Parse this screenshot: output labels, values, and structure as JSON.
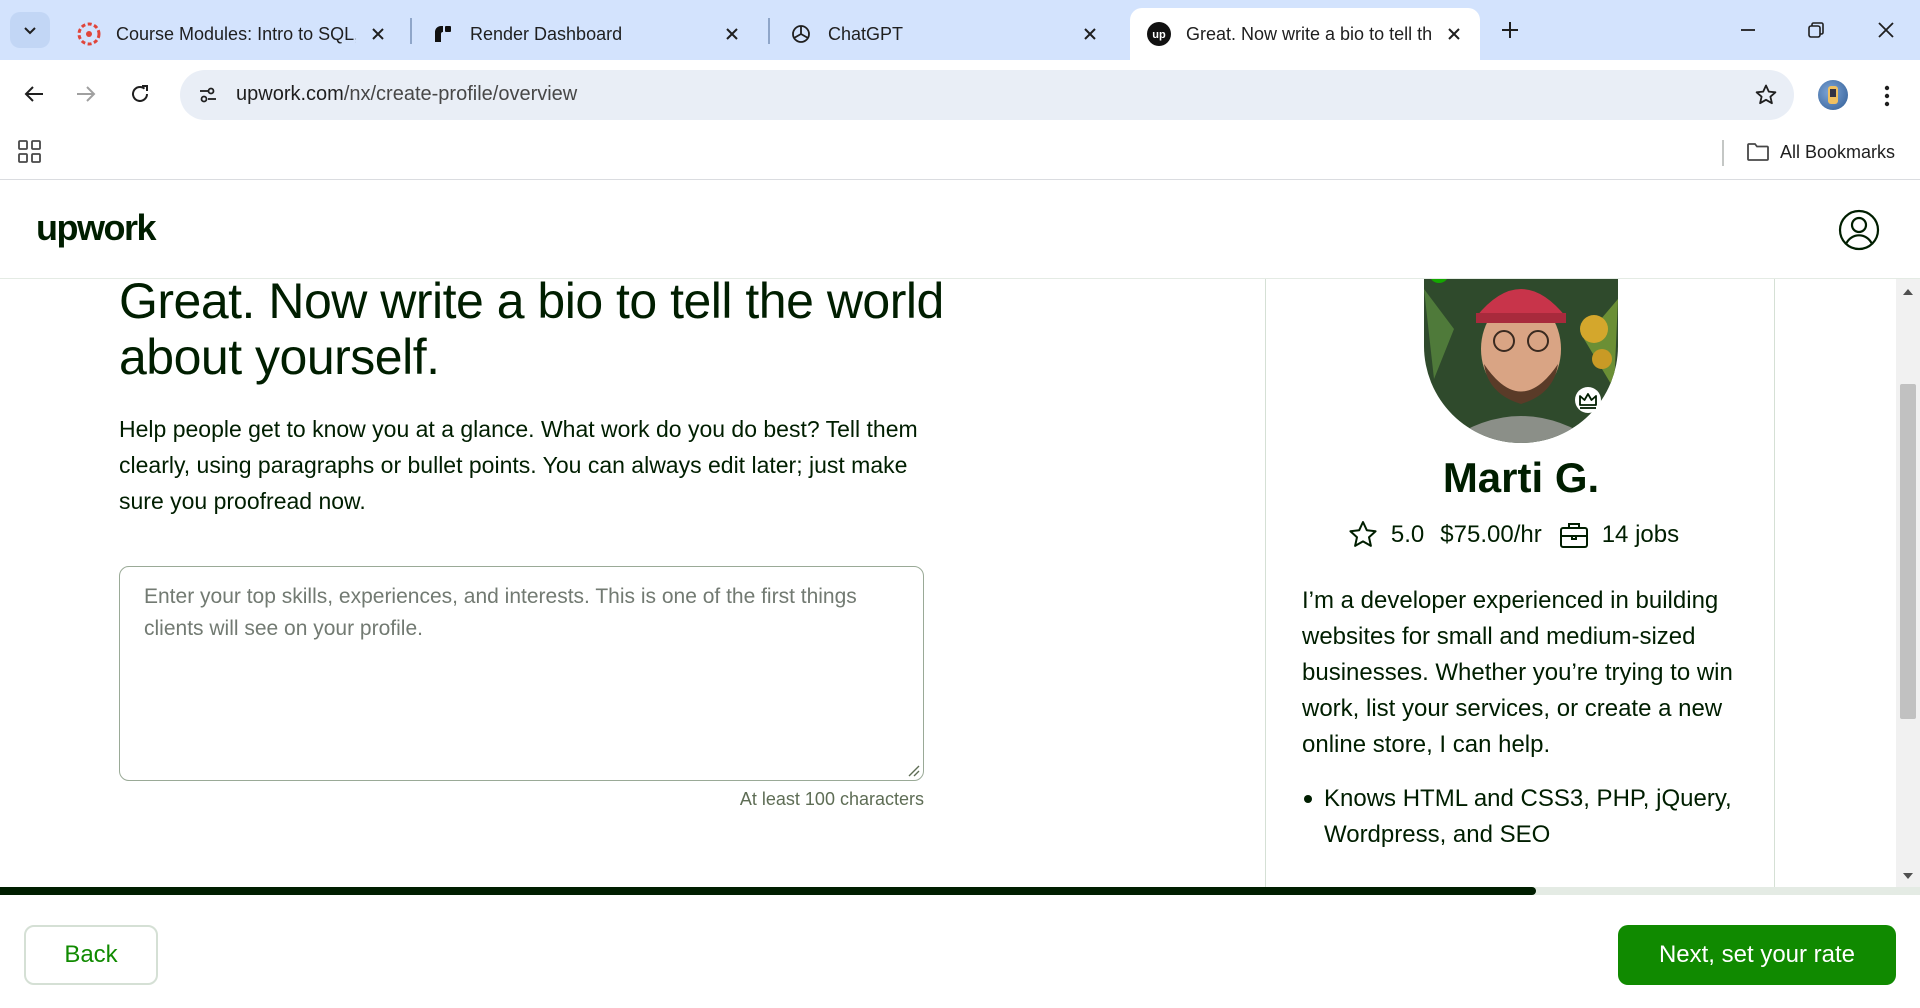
{
  "browser": {
    "tabs": [
      {
        "title": "Course Modules: Intro to SQL, S",
        "icon": "canvas-lms-icon",
        "active": false
      },
      {
        "title": "Render Dashboard",
        "icon": "render-icon",
        "active": false
      },
      {
        "title": "ChatGPT",
        "icon": "openai-icon",
        "active": false
      },
      {
        "title": "Great. Now write a bio to tell th",
        "icon": "upwork-icon",
        "active": true
      }
    ],
    "url_host": "upwork.com",
    "url_path": "/nx/create-profile/overview",
    "bookmarks_label": "All Bookmarks"
  },
  "site": {
    "logo": "upwork",
    "colors": {
      "brand_green": "#108a00",
      "text_dark": "#001e00",
      "online_green": "#14a800"
    }
  },
  "main": {
    "headline": "Great. Now write a bio to tell the world about yourself.",
    "subtext": "Help people get to know you at a glance. What work do you do best? Tell them clearly, using paragraphs or bullet points. You can always edit later; just make sure you proofread now.",
    "bio_placeholder": "Enter your top skills, experiences, and interests. This is one of the first things clients will see on your profile.",
    "char_hint": "At least 100 characters"
  },
  "preview": {
    "name": "Marti G.",
    "rating": "5.0",
    "rate": "$75.00/hr",
    "jobs": "14 jobs",
    "bio": "I’m a developer experienced in building websites for small and medium-sized businesses. Whether you’re trying to win work, list your services, or create a new online store, I can help.",
    "bullets": [
      "Knows HTML and CSS3, PHP, jQuery, Wordpress, and SEO"
    ]
  },
  "progress": {
    "fraction": 0.8
  },
  "footer": {
    "back_label": "Back",
    "next_label": "Next, set your rate"
  }
}
